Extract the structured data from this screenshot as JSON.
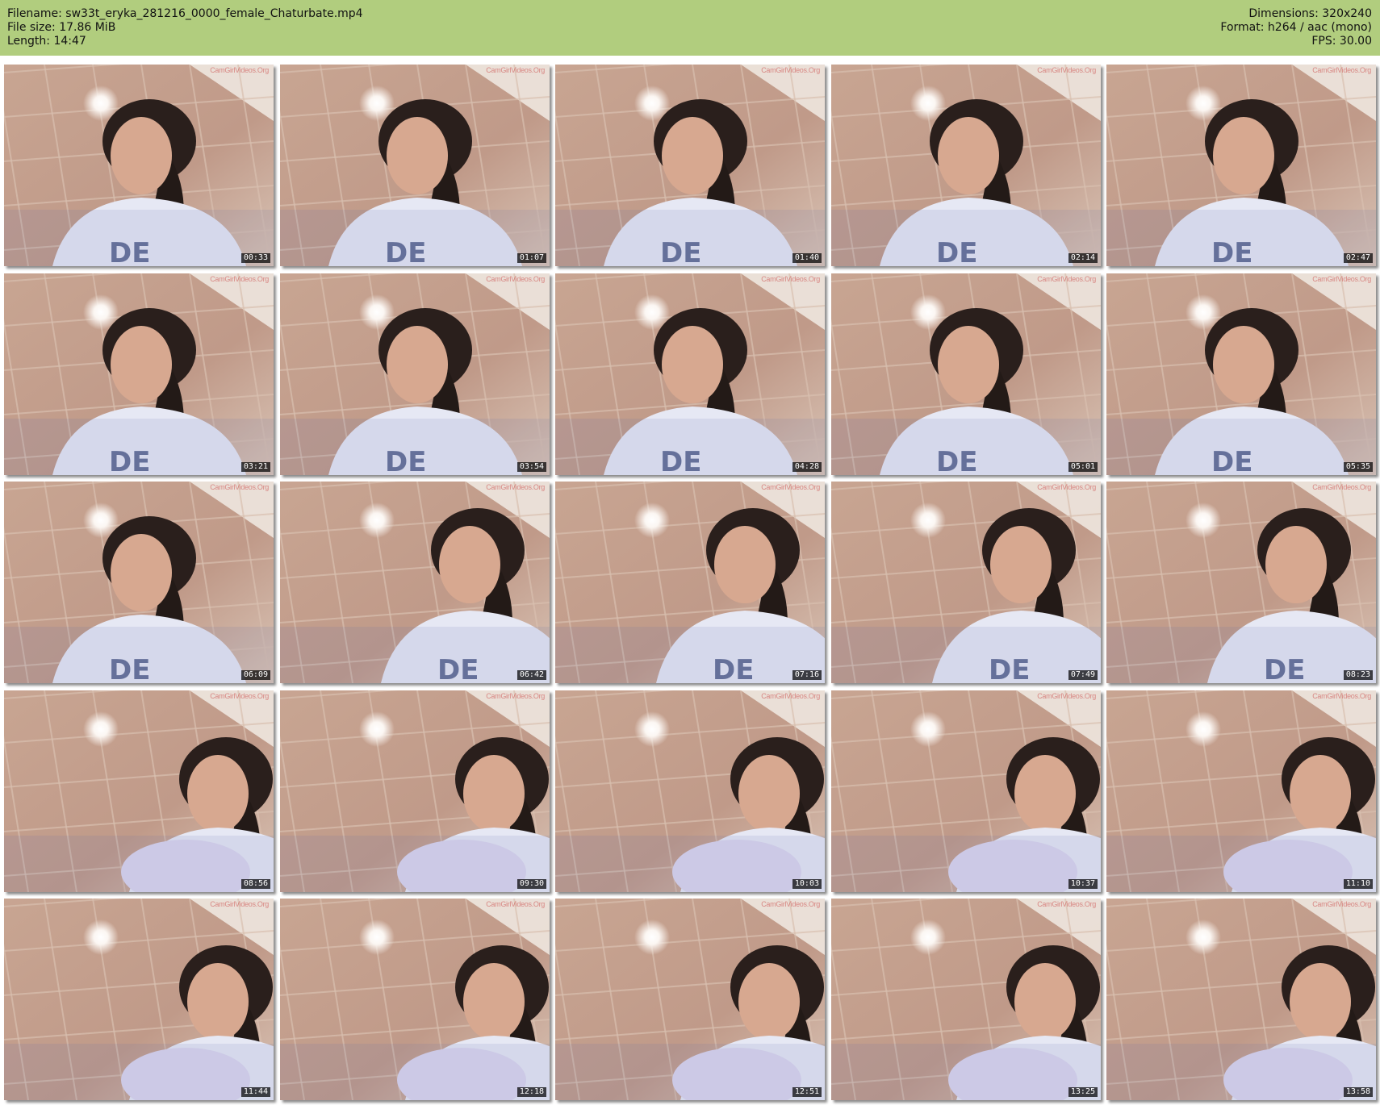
{
  "header": {
    "filename": "Filename: sw33t_eryka_281216_0000_female_Chaturbate.mp4",
    "filesize": "File size: 17.86 MiB",
    "length": "Length: 14:47",
    "dimensions": "Dimensions: 320x240",
    "format": "Format: h264 / aac (mono)",
    "fps": "FPS: 30.00"
  },
  "colors": {
    "header_bg": "#b1cd7e",
    "wall_tile": "#c9a690",
    "shirt": "#e8eaf6"
  },
  "thumbnails": [
    {
      "timestamp": "00:33",
      "watermark": "CamGirlVideos.Org",
      "pose": "center"
    },
    {
      "timestamp": "01:07",
      "watermark": "CamGirlVideos.Org",
      "pose": "center"
    },
    {
      "timestamp": "01:40",
      "watermark": "CamGirlVideos.Org",
      "pose": "center"
    },
    {
      "timestamp": "02:14",
      "watermark": "CamGirlVideos.Org",
      "pose": "center"
    },
    {
      "timestamp": "02:47",
      "watermark": "CamGirlVideos.Org",
      "pose": "center"
    },
    {
      "timestamp": "03:21",
      "watermark": "CamGirlVideos.Org",
      "pose": "center"
    },
    {
      "timestamp": "03:54",
      "watermark": "CamGirlVideos.Org",
      "pose": "center"
    },
    {
      "timestamp": "04:28",
      "watermark": "CamGirlVideos.Org",
      "pose": "center"
    },
    {
      "timestamp": "05:01",
      "watermark": "CamGirlVideos.Org",
      "pose": "center"
    },
    {
      "timestamp": "05:35",
      "watermark": "CamGirlVideos.Org",
      "pose": "center"
    },
    {
      "timestamp": "06:09",
      "watermark": "CamGirlVideos.Org",
      "pose": "center"
    },
    {
      "timestamp": "06:42",
      "watermark": "CamGirlVideos.Org",
      "pose": "right"
    },
    {
      "timestamp": "07:16",
      "watermark": "CamGirlVideos.Org",
      "pose": "right"
    },
    {
      "timestamp": "07:49",
      "watermark": "CamGirlVideos.Org",
      "pose": "right"
    },
    {
      "timestamp": "08:23",
      "watermark": "CamGirlVideos.Org",
      "pose": "right"
    },
    {
      "timestamp": "08:56",
      "watermark": "CamGirlVideos.Org",
      "pose": "pillow"
    },
    {
      "timestamp": "09:30",
      "watermark": "CamGirlVideos.Org",
      "pose": "pillow"
    },
    {
      "timestamp": "10:03",
      "watermark": "CamGirlVideos.Org",
      "pose": "pillow"
    },
    {
      "timestamp": "10:37",
      "watermark": "CamGirlVideos.Org",
      "pose": "pillow"
    },
    {
      "timestamp": "11:10",
      "watermark": "CamGirlVideos.Org",
      "pose": "pillow"
    },
    {
      "timestamp": "11:44",
      "watermark": "CamGirlVideos.Org",
      "pose": "pillow"
    },
    {
      "timestamp": "12:18",
      "watermark": "CamGirlVideos.Org",
      "pose": "pillow"
    },
    {
      "timestamp": "12:51",
      "watermark": "CamGirlVideos.Org",
      "pose": "pillow"
    },
    {
      "timestamp": "13:25",
      "watermark": "CamGirlVideos.Org",
      "pose": "pillow"
    },
    {
      "timestamp": "13:58",
      "watermark": "CamGirlVideos.Org",
      "pose": "pillow"
    }
  ]
}
